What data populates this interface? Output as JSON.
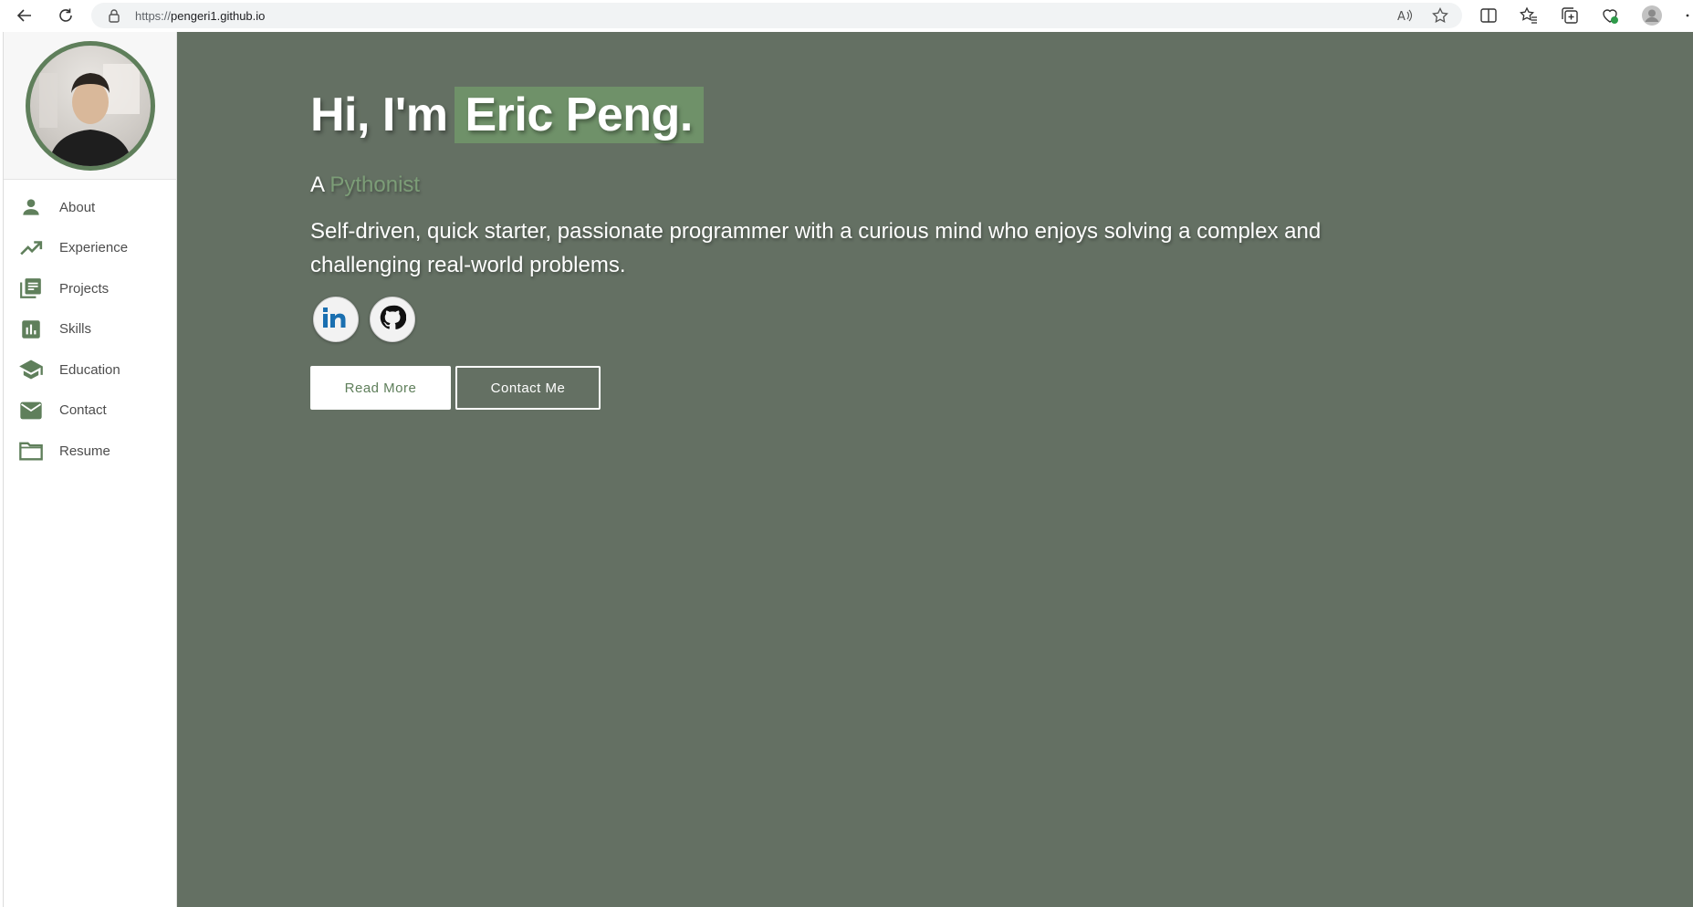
{
  "browser": {
    "url_scheme": "https://",
    "url_host": "pengeri1.github.io",
    "icons": [
      "back-arrow-icon",
      "refresh-icon",
      "lock-icon",
      "read-aloud-icon",
      "favorite-star-icon",
      "split-screen-icon",
      "favorites-icon",
      "collections-icon",
      "browser-essentials-icon",
      "profile-icon",
      "more-icon"
    ]
  },
  "sidebar": {
    "items": [
      {
        "label": "About",
        "icon": "person-icon"
      },
      {
        "label": "Experience",
        "icon": "trending-up-icon"
      },
      {
        "label": "Projects",
        "icon": "library-books-icon"
      },
      {
        "label": "Skills",
        "icon": "bar-chart-icon"
      },
      {
        "label": "Education",
        "icon": "school-icon"
      },
      {
        "label": "Contact",
        "icon": "mail-icon"
      },
      {
        "label": "Resume",
        "icon": "folder-icon"
      }
    ]
  },
  "hero": {
    "greeting_prefix": "Hi, I'm",
    "name": "Eric Peng.",
    "role_prefix": "A",
    "role": "Pythonist",
    "description": "Self-driven, quick starter, passionate programmer with a curious mind who enjoys solving a complex and challenging real-world problems.",
    "social": [
      {
        "icon": "linkedin-icon"
      },
      {
        "icon": "github-icon"
      }
    ],
    "read_more_label": "Read More",
    "contact_label": "Contact Me"
  },
  "colors": {
    "hero_bg": "#647063",
    "accent_green": "#5f7f5b",
    "name_highlight": "#6f9169",
    "role_text": "#7c9d77"
  }
}
